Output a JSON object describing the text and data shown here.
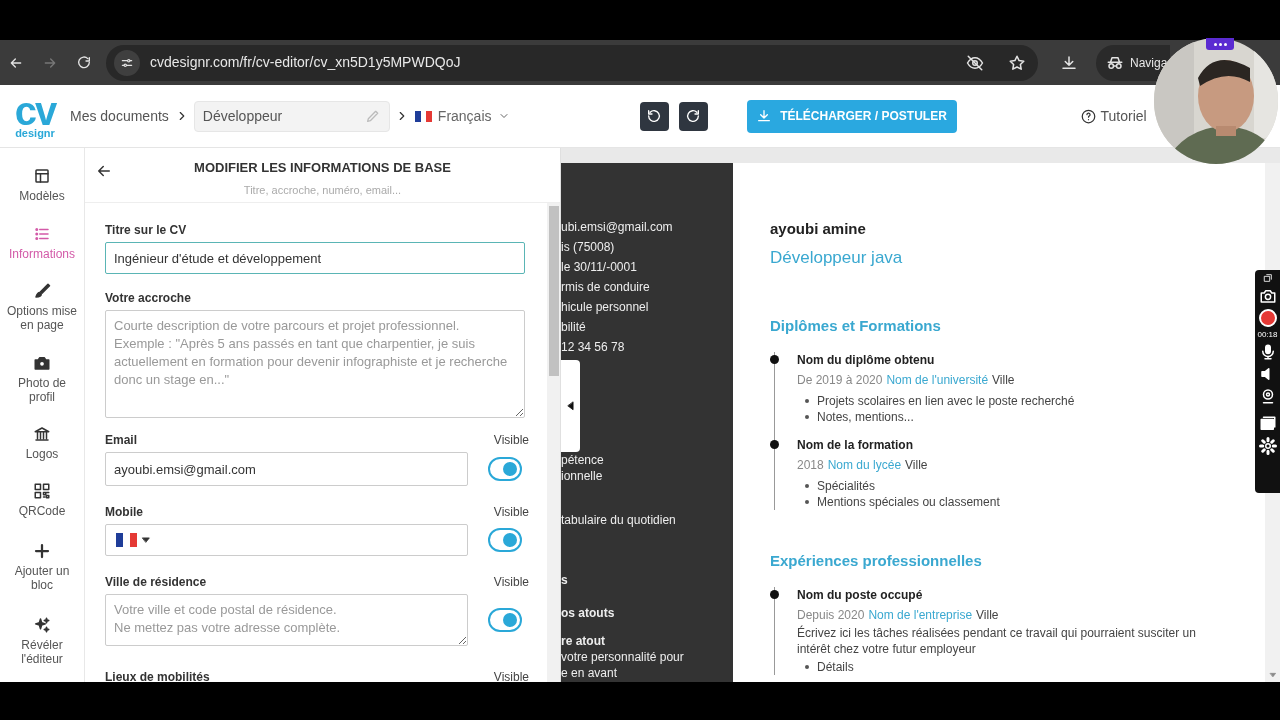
{
  "browser": {
    "url": "cvdesignr.com/fr/cv-editor/cv_xn5D1y5MPWDQoJ",
    "profile_label": "Naviga"
  },
  "header": {
    "logo_letters": "cv",
    "logo_word": "designr",
    "breadcrumb": "Mes documents",
    "document_name": "Développeur",
    "language": "Français",
    "download_button": "TÉLÉCHARGER / POSTULER",
    "help_link": "Tutoriel"
  },
  "sidebar": [
    {
      "label": "Modèles",
      "selected": false
    },
    {
      "label": "Informations",
      "selected": true
    },
    {
      "label": "Options mise en page",
      "selected": false
    },
    {
      "label": "Photo de profil",
      "selected": false
    },
    {
      "label": "Logos",
      "selected": false
    },
    {
      "label": "QRCode",
      "selected": false
    },
    {
      "label": "Ajouter un bloc",
      "selected": false
    },
    {
      "label": "Révéler l'éditeur",
      "selected": false
    }
  ],
  "panel": {
    "title": "MODIFIER LES INFORMATIONS DE BASE",
    "subtitle": "Titre, accroche, numéro, email...",
    "fields": [
      {
        "kind": "text",
        "label": "Titre sur le CV",
        "value": "Ingénieur d'étude et développement",
        "focused": true
      },
      {
        "kind": "textarea",
        "label": "Votre accroche",
        "placeholder": "Courte description de votre parcours et projet professionnel.\nExemple : \"Après 5 ans passés en tant que charpentier, je suis actuellement en formation pour devenir infographiste et je recherche donc un stage en...\""
      },
      {
        "kind": "text",
        "label": "Email",
        "value": "ayoubi.emsi@gmail.com",
        "visible_label": "Visible",
        "on": true
      },
      {
        "kind": "phone",
        "label": "Mobile",
        "visible_label": "Visible",
        "on": true
      },
      {
        "kind": "textarea",
        "label": "Ville de résidence",
        "placeholder": "Votre ville et code postal de résidence.\nNe mettez pas votre adresse complète.",
        "visible_label": "Visible",
        "on": true
      },
      {
        "kind": "cut",
        "label": "Lieux de mobilités",
        "visible_label": "Visible"
      }
    ]
  },
  "cv": {
    "dark_column": [
      {
        "lines": [
          {
            "text": "ubi.emsi@gmail.com",
            "bold": false
          },
          {
            "text": "is (75008)",
            "bold": false
          },
          {
            "text": "le 30/11/-0001",
            "bold": false
          },
          {
            "text": "rmis de conduire",
            "bold": false
          },
          {
            "text": "hicule personnel",
            "bold": false
          },
          {
            "text": "bilité",
            "bold": false
          },
          {
            "text": "12 34 56 78",
            "bold": false
          }
        ]
      },
      {
        "lines": [
          {
            "text": "pétence",
            "bold": false
          },
          {
            "text": "ionnelle",
            "bold": false
          }
        ]
      },
      {
        "lines": [
          {
            "text": "tabulaire du quotidien",
            "bold": false
          }
        ]
      },
      {
        "lines": [
          {
            "text": "s",
            "bold": true
          }
        ]
      },
      {
        "lines": [
          {
            "text": "os atouts",
            "bold": true
          }
        ]
      },
      {
        "lines": [
          {
            "text": "re atout",
            "bold": true
          },
          {
            "text": "votre personnalité pour",
            "bold": false
          },
          {
            "text": "e en avant",
            "bold": false
          }
        ]
      }
    ],
    "name": "ayoubi amine",
    "job_title": "Développeur java",
    "sections": [
      {
        "title": "Diplômes et Formations",
        "entries": [
          {
            "title": "Nom du diplôme obtenu",
            "date": "De 2019 à 2020",
            "place": "Nom de l'université",
            "city": "Ville",
            "bullets": [
              "Projets scolaires en lien avec le poste recherché",
              "Notes, mentions..."
            ]
          },
          {
            "title": "Nom de la formation",
            "date": "2018",
            "place": "Nom du lycée",
            "city": "Ville",
            "bullets": [
              "Spécialités",
              "Mentions spéciales ou classement"
            ]
          }
        ]
      },
      {
        "title": "Expériences professionnelles",
        "entries": [
          {
            "title": "Nom du poste occupé",
            "date": "Depuis 2020",
            "place": "Nom de l'entreprise",
            "city": "Ville",
            "description": "Écrivez ici les tâches réalisées pendant ce travail qui pourraient susciter un intérêt chez votre futur employeur",
            "bullets": [
              "Détails"
            ]
          }
        ]
      }
    ]
  },
  "recorder": {
    "timer": "00:18"
  }
}
